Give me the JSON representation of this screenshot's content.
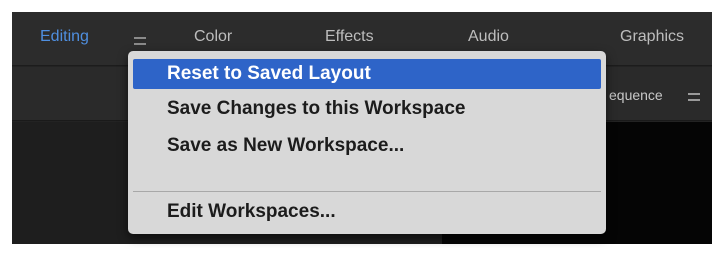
{
  "workspace_tabs": [
    {
      "label": "Editing",
      "active": true
    },
    {
      "label": "Color",
      "active": false
    },
    {
      "label": "Effects",
      "active": false
    },
    {
      "label": "Audio",
      "active": false
    },
    {
      "label": "Graphics",
      "active": false
    }
  ],
  "panel": {
    "tab_label": "equence"
  },
  "dropdown": {
    "items": [
      {
        "label": "Reset to Saved Layout",
        "highlighted": true
      },
      {
        "label": "Save Changes to this Workspace",
        "highlighted": false
      },
      {
        "label": "Save as New Workspace...",
        "highlighted": false
      },
      {
        "label": "Edit Workspaces...",
        "highlighted": false
      }
    ]
  },
  "colors": {
    "accent": "#4f8fe0",
    "highlight": "#2e64c8",
    "menu_bg": "#d8d8d8",
    "app_bg": "#232323"
  }
}
